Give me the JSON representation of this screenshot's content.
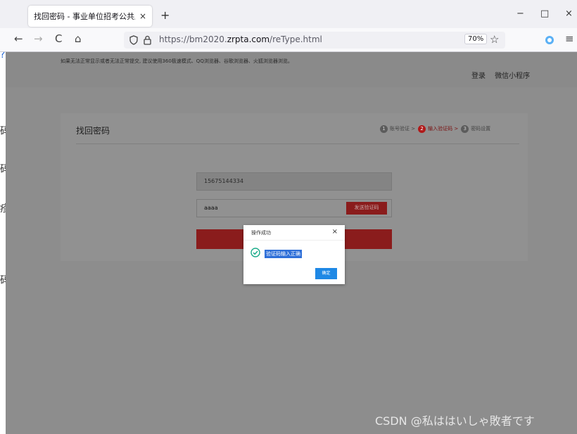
{
  "browser": {
    "tab_title": "找回密码 - 事业单位招考公共服务平",
    "tab_close": "×",
    "new_tab": "+",
    "win_min": "−",
    "win_max": "□",
    "win_close": "×",
    "back": "←",
    "forward": "→",
    "reload": "C",
    "home": "⌂",
    "url_prefix": "https://bm2020.",
    "url_domain": "zrpta.com",
    "url_path": "/reType.html",
    "zoom": "70%",
    "star": "☆",
    "menu": "≡"
  },
  "page": {
    "notice": "如果无法正常显示或者无法正常提交, 建议使用360极速模式、QQ浏览器、谷歌浏览器、火狐浏览器浏览。",
    "links": [
      "登录",
      "微信小程序"
    ],
    "card_title": "找回密码",
    "steps": [
      {
        "num": "1",
        "label": "账号验证 >"
      },
      {
        "num": "2",
        "label": "输入验证码 >"
      },
      {
        "num": "3",
        "label": "密码设置"
      }
    ],
    "phone_value": "15675144334",
    "code_value": "aaaa",
    "send_code_label": "发送验证码"
  },
  "dialog": {
    "title": "操作成功",
    "close": "×",
    "message": "验证码输入正确",
    "confirm_label": "确定"
  },
  "bleed": [
    "?",
    "码",
    "码",
    "疹",
    "码"
  ],
  "watermark": "CSDN @私ははいしゃ敗者です",
  "colors": {
    "accent_red": "#b01a1a",
    "dialog_button": "#1e88e5",
    "success_green": "#1aab8a"
  }
}
